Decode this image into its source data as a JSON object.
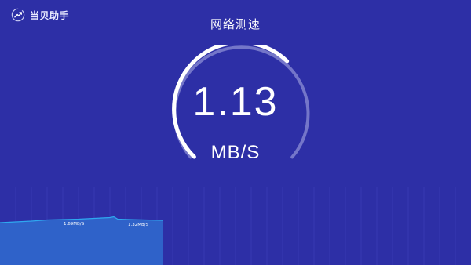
{
  "brand": {
    "name": "当贝助手",
    "logo_icon": "dangbei-logo-icon"
  },
  "header": {
    "title": "网络测速"
  },
  "speed": {
    "value": "1.13",
    "unit": "MB/S",
    "gauge_progress": 0.66
  },
  "history": {
    "labels": [
      "1.69MB/S",
      "1.32MB/S"
    ]
  },
  "colors": {
    "background": "#2d2fa6",
    "arc_active": "#ffffff",
    "arc_track": "#7476c9",
    "graph_fill": "#2f62c9",
    "graph_line": "#2ea8f0"
  }
}
